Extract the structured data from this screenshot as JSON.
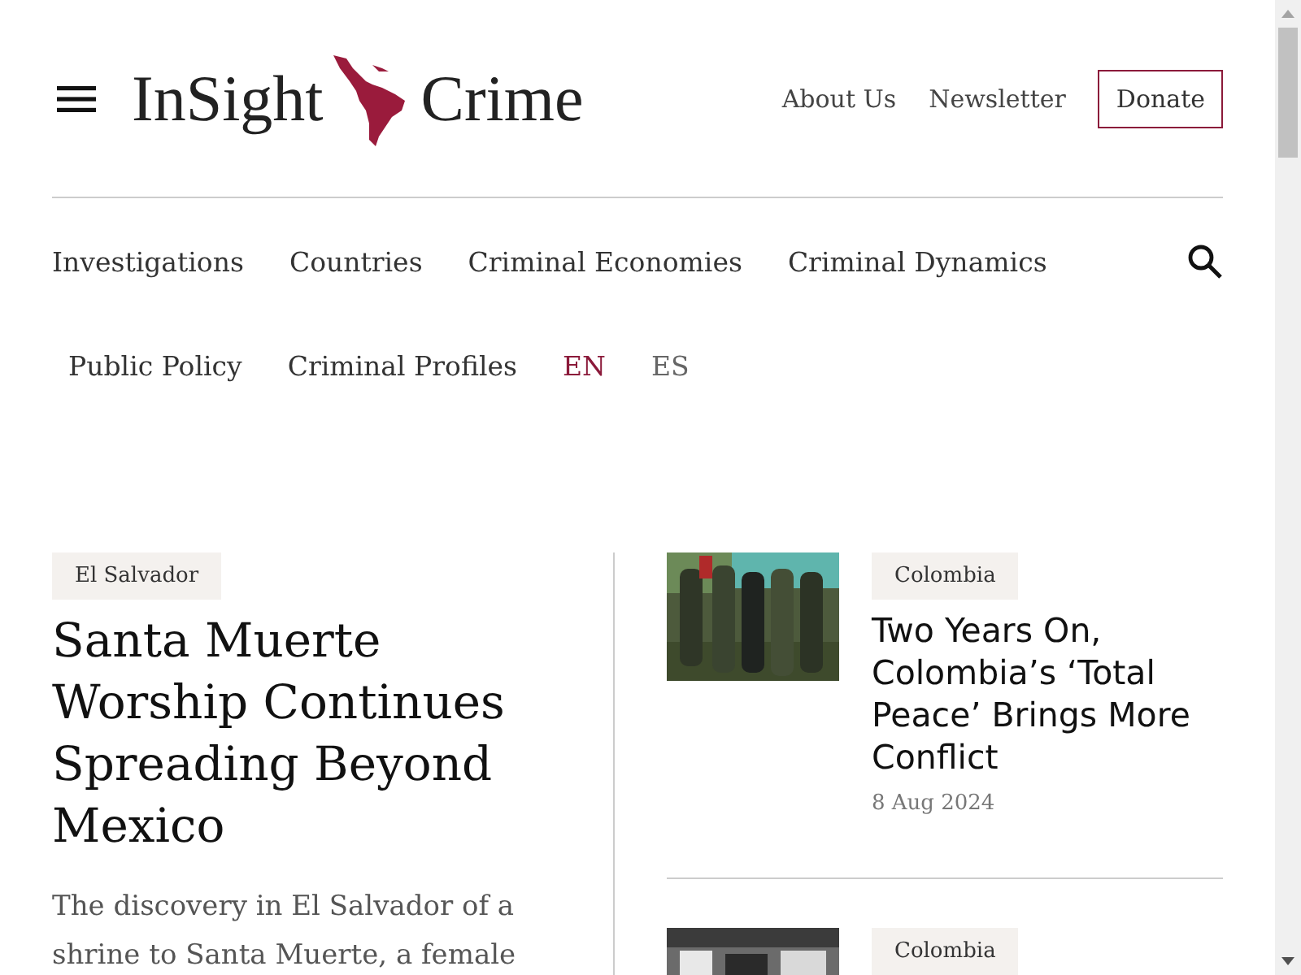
{
  "header": {
    "logo": {
      "left": "InSight",
      "right": "Crime"
    },
    "links": [
      "About Us",
      "Newsletter"
    ],
    "donate": "Donate"
  },
  "nav": {
    "items": [
      "Investigations",
      "Countries",
      "Criminal Economies",
      "Criminal Dynamics",
      "Public Policy",
      "Criminal Profiles"
    ],
    "languages": [
      {
        "label": "EN",
        "selected": true
      },
      {
        "label": "ES",
        "selected": false
      }
    ]
  },
  "featured": {
    "tag": "El Salvador",
    "title": "Santa Muerte Worship Continues Spreading Beyond Mexico",
    "summary": "The discovery in El Salvador of a shrine to Santa Muerte, a female"
  },
  "articles": [
    {
      "kind": "picture",
      "tag": "Colombia",
      "title": "Two Years On, Colombia’s ‘Total Peace’ Brings More Conflict",
      "date": "8 Aug 2024"
    },
    {
      "kind": "picture",
      "tag": "Colombia"
    }
  ]
}
